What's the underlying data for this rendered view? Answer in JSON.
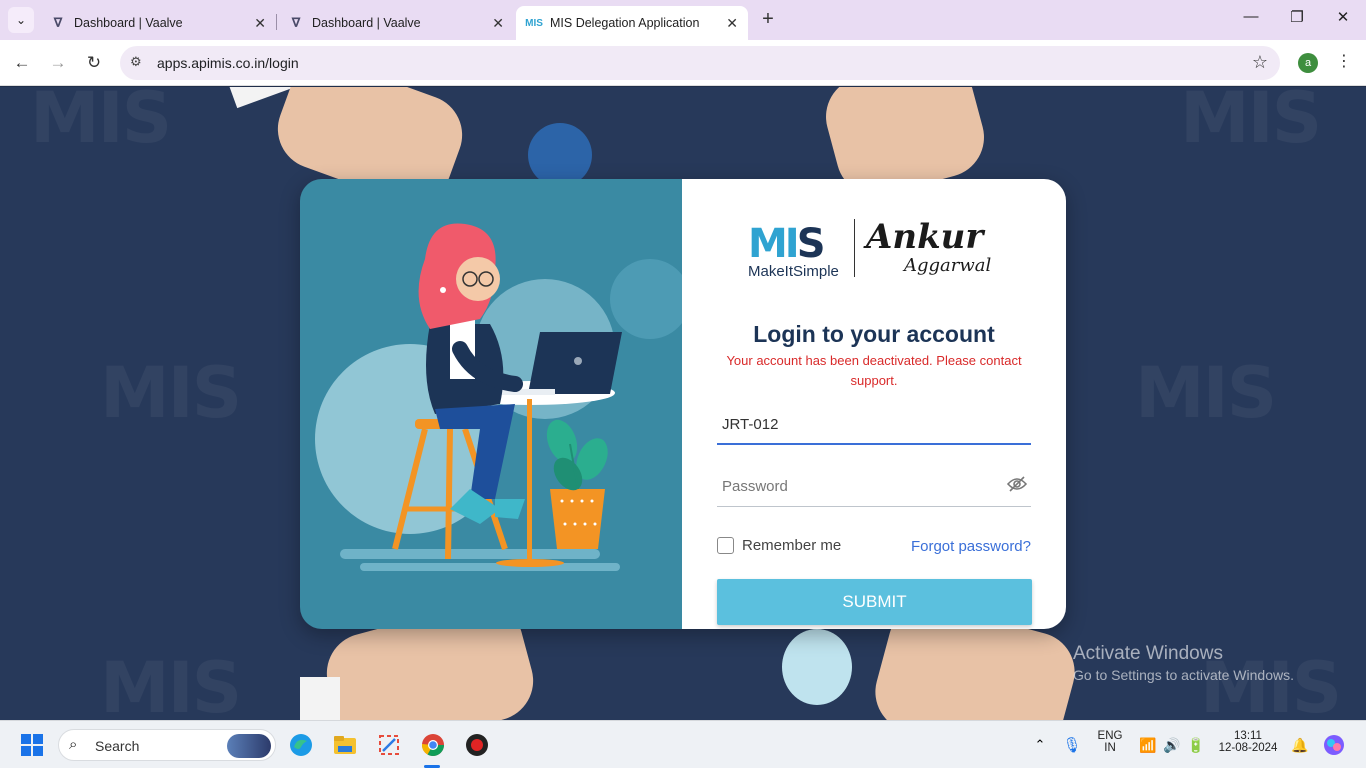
{
  "browser": {
    "tabs": [
      {
        "title": "Dashboard | Vaalve",
        "favicon": "V",
        "active": false
      },
      {
        "title": "Dashboard | Vaalve",
        "favicon": "V",
        "active": false
      },
      {
        "title": "MIS Delegation Application",
        "favicon": "MIS",
        "active": true
      }
    ],
    "url": "apps.apimis.co.in/login",
    "profile_initial": "a"
  },
  "login": {
    "logo_mark": "MI",
    "logo_mark_s": "S",
    "logo_subtitle": "MakeItSimple",
    "signature_line1": "Ankur",
    "signature_line2": "Aggarwal",
    "title": "Login to your account",
    "error": "Your account has been deactivated. Please contact support.",
    "username_value": "JRT-012",
    "password_placeholder": "Password",
    "remember_label": "Remember me",
    "remember_checked": false,
    "forgot_label": "Forgot password?",
    "submit_label": "SUBMIT"
  },
  "watermark": {
    "line1": "Activate Windows",
    "line2": "Go to Settings to activate Windows."
  },
  "taskbar": {
    "search_label": "Search",
    "language_line1": "ENG",
    "language_line2": "IN",
    "time": "13:11",
    "date": "12-08-2024"
  },
  "colors": {
    "accent_blue": "#3a6fd8",
    "error_red": "#d92a2a",
    "submit_bg": "#5bc0de",
    "brand_navy": "#1c3456",
    "brand_cyan": "#2fa3d1"
  }
}
